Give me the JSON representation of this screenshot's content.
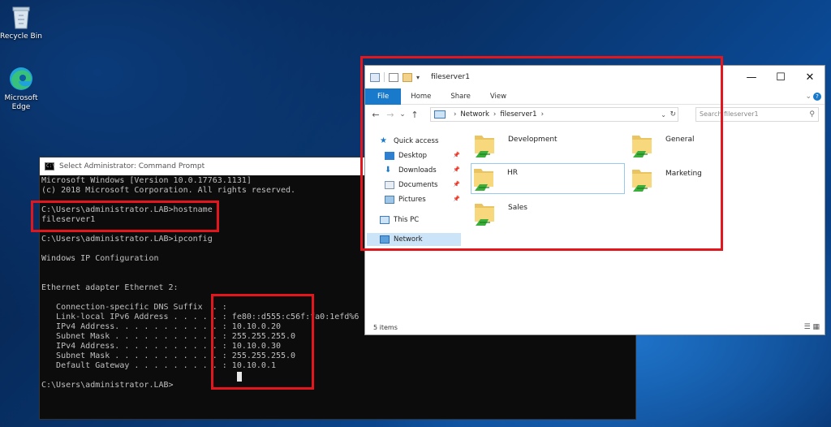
{
  "desktop": {
    "icons": [
      {
        "label": "Recycle Bin",
        "icon": "recycle-bin-icon"
      },
      {
        "label": "Microsoft Edge",
        "icon": "edge-icon"
      }
    ]
  },
  "cmd": {
    "title": "Select Administrator: Command Prompt",
    "lines": [
      "Microsoft Windows [Version 10.0.17763.1131]",
      "(c) 2018 Microsoft Corporation. All rights reserved.",
      "",
      "C:\\Users\\administrator.LAB>hostname",
      "fileserver1",
      "",
      "C:\\Users\\administrator.LAB>ipconfig",
      "",
      "Windows IP Configuration",
      "",
      "",
      "Ethernet adapter Ethernet 2:",
      "",
      "   Connection-specific DNS Suffix  . :",
      "   Link-local IPv6 Address . . . . . : fe80::d555:c56f:fa0:1efd%6",
      "   IPv4 Address. . . . . . . . . . . : 10.10.0.20",
      "   Subnet Mask . . . . . . . . . . . : 255.255.255.0",
      "   IPv4 Address. . . . . . . . . . . : 10.10.0.30",
      "   Subnet Mask . . . . . . . . . . . : 255.255.255.0",
      "   Default Gateway . . . . . . . . . : 10.10.0.1",
      "",
      "C:\\Users\\administrator.LAB>"
    ]
  },
  "explorer": {
    "title": "fileserver1",
    "window_controls": {
      "minimize": "—",
      "maximize": "☐",
      "close": "✕"
    },
    "ribbon_tabs": [
      "File",
      "Home",
      "Share",
      "View"
    ],
    "nav_buttons": {
      "back": "←",
      "forward": "→",
      "recent": "⌄",
      "up": "↑"
    },
    "address": {
      "segments": [
        "Network",
        "fileserver1"
      ],
      "separator": "›"
    },
    "search_placeholder": "Search fileserver1",
    "sidebar": [
      {
        "label": "Quick access",
        "icon": "star-icon"
      },
      {
        "label": "Desktop",
        "icon": "desktop-folder-icon",
        "pinned": true
      },
      {
        "label": "Downloads",
        "icon": "downloads-icon",
        "pinned": true
      },
      {
        "label": "Documents",
        "icon": "documents-icon",
        "pinned": true
      },
      {
        "label": "Pictures",
        "icon": "pictures-icon",
        "pinned": true
      },
      {
        "label": "This PC",
        "icon": "this-pc-icon"
      },
      {
        "label": "Network",
        "icon": "network-icon",
        "selected": true
      }
    ],
    "folders": [
      {
        "label": "Development"
      },
      {
        "label": "General"
      },
      {
        "label": "HR",
        "selected": true
      },
      {
        "label": "Marketing"
      },
      {
        "label": "Sales"
      }
    ],
    "status": "5 items"
  },
  "colors": {
    "highlight_box": "#e3151d",
    "ribbon_file": "#1979ca"
  }
}
